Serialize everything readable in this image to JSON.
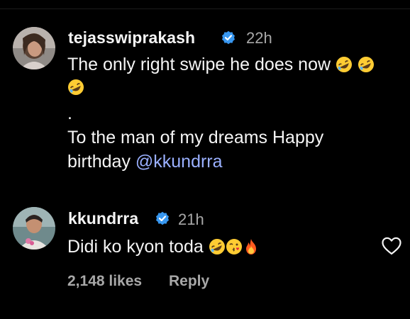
{
  "comments": [
    {
      "username": "tejasswiprakash",
      "verified": true,
      "time": "22h",
      "line1": "The only right swipe he does now",
      "line3": ".",
      "line4": "To the man of my dreams Happy",
      "line5_prefix": "birthday ",
      "mention": "@kkundrra",
      "emojis": [
        "rofl",
        "rofl",
        "rofl"
      ]
    },
    {
      "username": "kkundrra",
      "verified": true,
      "time": "21h",
      "text": "Didi ko kyon toda",
      "emojis": [
        "rofl",
        "kiss",
        "fire"
      ],
      "likes": "2,148 likes",
      "reply_label": "Reply",
      "icon": "heart-outline-icon"
    }
  ],
  "colors": {
    "background": "#000000",
    "text": "#f5f5f5",
    "secondary": "#a8a8a8",
    "mention": "#9ab0ff",
    "verified": "#3897f0"
  }
}
